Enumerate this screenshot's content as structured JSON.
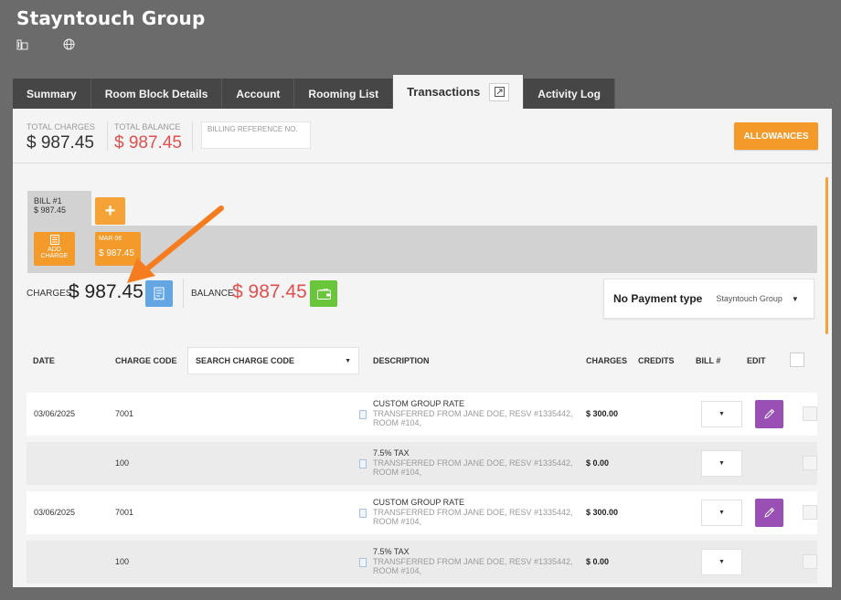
{
  "header": {
    "title": "Stayntouch Group"
  },
  "icons": {
    "building": "building-icon",
    "globe": "globe-icon",
    "expand": "expand-icon",
    "receipt": "receipt-icon",
    "wallet": "wallet-icon",
    "pencil": "pencil-icon",
    "document": "document-icon"
  },
  "tabs": [
    {
      "label": "Summary"
    },
    {
      "label": "Room Block Details"
    },
    {
      "label": "Account"
    },
    {
      "label": "Rooming List"
    },
    {
      "label": "Transactions"
    },
    {
      "label": "Activity Log"
    }
  ],
  "summary": {
    "total_charges_label": "TOTAL CHARGES",
    "total_charges": "$ 987.45",
    "total_balance_label": "TOTAL BALANCE",
    "total_balance": "$ 987.45",
    "billing_ref_label": "BILLING REFERENCE NO.",
    "allowances_label": "ALLOWANCES"
  },
  "bill": {
    "name": "BILL #1",
    "amount": "$ 987.45",
    "add_label": "+",
    "add_charge_line1": "ADD",
    "add_charge_line2": "CHARGE",
    "date_chip_date": "MAR 06",
    "date_chip_amount": "$ 987.45"
  },
  "totals": {
    "charges_label": "CHARGES",
    "charges_value": "$ 987.45",
    "balance_label": "BALANCE",
    "balance_value": "$ 987.45"
  },
  "payment": {
    "type_label": "No Payment type",
    "group": "Stayntouch Group"
  },
  "table": {
    "headers": {
      "date": "DATE",
      "charge_code": "CHARGE CODE",
      "search_placeholder": "SEARCH CHARGE CODE",
      "description": "DESCRIPTION",
      "charges": "CHARGES",
      "credits": "CREDITS",
      "bill": "BILL #",
      "edit": "EDIT"
    },
    "rows": [
      {
        "date": "03/06/2025",
        "code": "7001",
        "title": "CUSTOM GROUP RATE",
        "line1": "TRANSFERRED FROM JANE DOE, RESV #1335442,",
        "line2": "ROOM #104,",
        "amount": "$ 300.00",
        "editable": true
      },
      {
        "date": "",
        "code": "100",
        "title": "7.5% TAX",
        "line1": "TRANSFERRED FROM JANE DOE, RESV #1335442,",
        "line2": "ROOM #104,",
        "amount": "$ 0.00",
        "editable": false
      },
      {
        "date": "03/06/2025",
        "code": "7001",
        "title": "CUSTOM GROUP RATE",
        "line1": "TRANSFERRED FROM JANE DOE, RESV #1335442,",
        "line2": "ROOM #104,",
        "amount": "$ 300.00",
        "editable": true
      },
      {
        "date": "",
        "code": "100",
        "title": "7.5% TAX",
        "line1": "TRANSFERRED FROM JANE DOE, RESV #1335442,",
        "line2": "ROOM #104,",
        "amount": "$ 0.00",
        "editable": false
      }
    ]
  },
  "colors": {
    "accent_orange": "#f39a2b",
    "balance_red": "#e05050",
    "edit_purple": "#9a4fb5",
    "charges_blue": "#63a6e3",
    "wallet_green": "#69c53a"
  }
}
